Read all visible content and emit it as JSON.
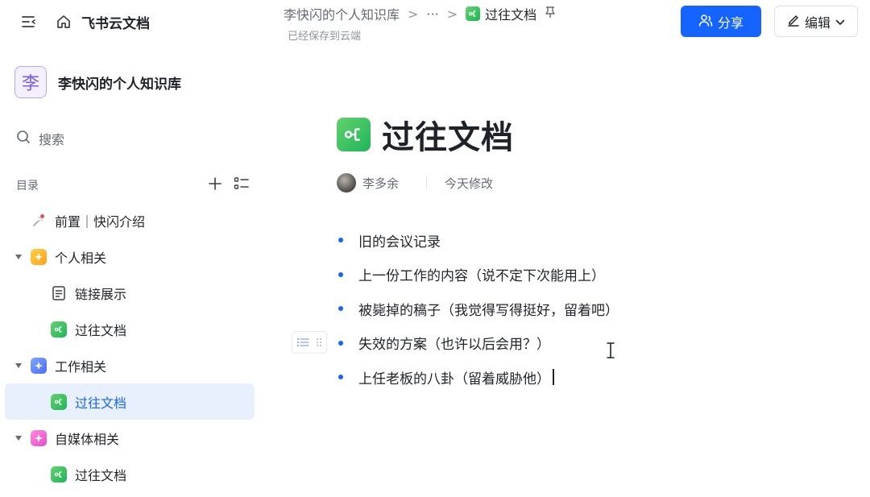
{
  "app": {
    "title": "飞书云文档"
  },
  "breadcrumb": {
    "space": "李快闪的个人知识库",
    "ellipsis": "···",
    "sep": ">",
    "current": "过往文档",
    "pin_icon": "pin-icon"
  },
  "save_status": "已经保存到云端",
  "actions": {
    "share_label": "分享",
    "edit_label": "编辑"
  },
  "sidebar": {
    "space_avatar": "李",
    "space_name": "李快闪的个人知识库",
    "search_label": "搜索",
    "toc_label": "目录",
    "items": [
      {
        "label": "前置｜快闪介绍",
        "icon": "pin-emoji-icon",
        "level": 0,
        "arrow": false
      },
      {
        "label": "个人相关",
        "icon": "yellow-spark-icon",
        "level": 0,
        "arrow": true
      },
      {
        "label": "链接展示",
        "icon": "doc-icon",
        "level": 1
      },
      {
        "label": "过往文档",
        "icon": "green-mindnote-icon",
        "level": 1
      },
      {
        "label": "工作相关",
        "icon": "blue-spark-icon",
        "level": 0,
        "arrow": true
      },
      {
        "label": "过往文档",
        "icon": "green-mindnote-icon",
        "level": 1,
        "active": true
      },
      {
        "label": "自媒体相关",
        "icon": "pink-spark-icon",
        "level": 0,
        "arrow": true
      },
      {
        "label": "过往文档",
        "icon": "green-mindnote-icon",
        "level": 1
      }
    ]
  },
  "document": {
    "title": "过往文档",
    "author": "李多余",
    "modified": "今天修改",
    "bullets": [
      "旧的会议记录",
      "上一份工作的内容（说不定下次能用上）",
      "被毙掉的稿子（我觉得写得挺好，留着吧）",
      "失效的方案（也许以后会用？）",
      "上任老板的八卦（留着威胁他）"
    ]
  },
  "colors": {
    "accent": "#1664ff",
    "active_bg": "#e8f0fe",
    "text": "#1f2329",
    "muted": "#646a73"
  }
}
